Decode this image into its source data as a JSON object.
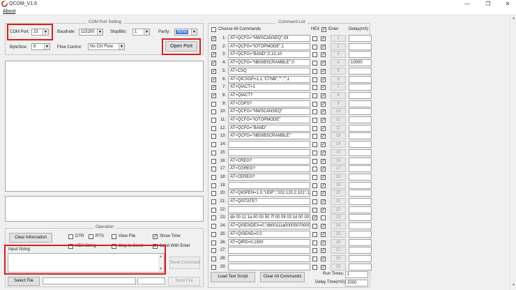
{
  "window": {
    "title": "QCOM_V1.6",
    "menu": [
      "About"
    ]
  },
  "com_setting": {
    "group_title": "COM Port Setting",
    "com_port_label": "COM Port:",
    "com_port_value": "23",
    "baudrate_label": "Baudrate:",
    "baudrate_value": "115200",
    "stopbits_label": "StopBits:",
    "stopbits_value": "1",
    "parity_label": "Parity:",
    "parity_value": "None",
    "bytesize_label": "ByteSize:",
    "bytesize_value": "8",
    "flow_control_label": "Flow Control:",
    "flow_control_value": "No Ctrl Flow",
    "open_port_label": "Open Port"
  },
  "operation": {
    "group_title": "Operation",
    "clear_information": "Clear Information",
    "dtr": "DTR",
    "rts": "RTS",
    "view_file": "View File",
    "show_time": "Show Time",
    "hex_string": "HEX String",
    "stop_to_send": "Stop to Send",
    "send_with_enter": "Send With Enter",
    "input_string_label": "Input String:",
    "send_command": "Send Command",
    "select_file": "Select File",
    "send_file": "Send File",
    "checked": {
      "show_time": true,
      "send_with_enter": true
    }
  },
  "command_list": {
    "group_title": "Command List",
    "choose_all": "Choose All Commands",
    "hex_header": "HEX",
    "enter_header": "Enter",
    "delay_header": "Delay(mS)",
    "rows": [
      {
        "num": "1:",
        "cmd": "AT+QCFG=\"NWSCANSEQ\",03",
        "checked": true,
        "hex": false,
        "enter": true,
        "btn": "1",
        "delay": ""
      },
      {
        "num": "2:",
        "cmd": "AT+QCFG=\"IOTOPMODE\",1",
        "checked": true,
        "hex": false,
        "enter": true,
        "btn": "2",
        "delay": ""
      },
      {
        "num": "3:",
        "cmd": "AT+QCFG=\"BAND\",0,10,10",
        "checked": true,
        "hex": false,
        "enter": true,
        "btn": "3",
        "delay": ""
      },
      {
        "num": "4:",
        "cmd": "AT+QCFG=\"NBSIBSCRAMBLE\",0",
        "checked": true,
        "hex": false,
        "enter": true,
        "btn": "4",
        "delay": "10000"
      },
      {
        "num": "5:",
        "cmd": "AT+CSQ",
        "checked": true,
        "hex": false,
        "enter": true,
        "btn": "5",
        "delay": ""
      },
      {
        "num": "6:",
        "cmd": "AT+QICSGP=1,1,\"CTNB\",\"\",\"\",1",
        "checked": true,
        "hex": false,
        "enter": true,
        "btn": "6",
        "delay": ""
      },
      {
        "num": "7:",
        "cmd": "AT+QIACT=1",
        "checked": true,
        "hex": false,
        "enter": true,
        "btn": "7",
        "delay": ""
      },
      {
        "num": "8:",
        "cmd": "AT+QIACT?",
        "checked": true,
        "hex": false,
        "enter": true,
        "btn": "8",
        "delay": ""
      },
      {
        "num": "9:",
        "cmd": "AT+COPS?",
        "checked": false,
        "hex": false,
        "enter": true,
        "btn": "9",
        "delay": ""
      },
      {
        "num": "10:",
        "cmd": "AT+QCFG=\"NWSCANSEQ\"",
        "checked": false,
        "hex": false,
        "enter": true,
        "btn": "10",
        "delay": ""
      },
      {
        "num": "11:",
        "cmd": "AT+QCFG=\"IOTOPMODE\"",
        "checked": false,
        "hex": false,
        "enter": true,
        "btn": "11",
        "delay": ""
      },
      {
        "num": "12:",
        "cmd": "AT+QCFG=\"BAND\"",
        "checked": false,
        "hex": false,
        "enter": true,
        "btn": "12",
        "delay": ""
      },
      {
        "num": "13:",
        "cmd": "AT+QCFG=\"NBSIBSCRAMBLE\"",
        "checked": false,
        "hex": false,
        "enter": true,
        "btn": "13",
        "delay": ""
      },
      {
        "num": "14:",
        "cmd": "",
        "checked": false,
        "hex": false,
        "enter": true,
        "btn": "14",
        "delay": ""
      },
      {
        "num": "15:",
        "cmd": "",
        "checked": false,
        "hex": false,
        "enter": true,
        "btn": "15",
        "delay": ""
      },
      {
        "num": "16:",
        "cmd": "AT+CREG?",
        "checked": false,
        "hex": false,
        "enter": true,
        "btn": "16",
        "delay": ""
      },
      {
        "num": "17:",
        "cmd": "AT+CGREG?",
        "checked": false,
        "hex": false,
        "enter": true,
        "btn": "17",
        "delay": ""
      },
      {
        "num": "18:",
        "cmd": "AT+CEREG?",
        "checked": false,
        "hex": false,
        "enter": true,
        "btn": "18",
        "delay": ""
      },
      {
        "num": "19:",
        "cmd": "",
        "checked": false,
        "hex": false,
        "enter": true,
        "btn": "19",
        "delay": ""
      },
      {
        "num": "20:",
        "cmd": "AT+QIOPEN=1,0,\"UDP\",\"202.120.2.101\",12",
        "checked": false,
        "hex": false,
        "enter": true,
        "btn": "20",
        "delay": ""
      },
      {
        "num": "21:",
        "cmd": "AT+QISTATE?",
        "checked": false,
        "hex": false,
        "enter": true,
        "btn": "21",
        "delay": ""
      },
      {
        "num": "22:",
        "cmd": "",
        "checked": false,
        "hex": false,
        "enter": true,
        "btn": "22",
        "delay": ""
      },
      {
        "num": "23:",
        "cmd": "db 00 11 1a 00 00 50 7f 00 09 03 1d 00 00 00",
        "checked": false,
        "hex": true,
        "enter": false,
        "btn": "23",
        "delay": ""
      },
      {
        "num": "24:",
        "cmd": "AT+QISENDEX=0,\"db00111a000050700009",
        "checked": false,
        "hex": false,
        "enter": true,
        "btn": "24",
        "delay": ""
      },
      {
        "num": "25:",
        "cmd": "AT+QISEND=0,0",
        "checked": false,
        "hex": false,
        "enter": true,
        "btn": "25",
        "delay": ""
      },
      {
        "num": "26:",
        "cmd": "AT+QIRD=0,1500",
        "checked": false,
        "hex": false,
        "enter": true,
        "btn": "26",
        "delay": ""
      },
      {
        "num": "27:",
        "cmd": "",
        "checked": false,
        "hex": false,
        "enter": true,
        "btn": "27",
        "delay": ""
      },
      {
        "num": "28:",
        "cmd": "",
        "checked": false,
        "hex": false,
        "enter": true,
        "btn": "28",
        "delay": ""
      },
      {
        "num": "29:",
        "cmd": "",
        "checked": false,
        "hex": false,
        "enter": true,
        "btn": "29",
        "delay": ""
      }
    ],
    "load_text_script": "Load Text Script",
    "clear_all_commands": "Clear All Commands",
    "run_times_label": "Run Times:",
    "run_times_value": "1",
    "delay_time_label": "Delay Time(mS):",
    "delay_time_value": "2000"
  },
  "colors": {
    "highlight_red": "#e0191f",
    "selected_blue": "#3a78d8"
  }
}
